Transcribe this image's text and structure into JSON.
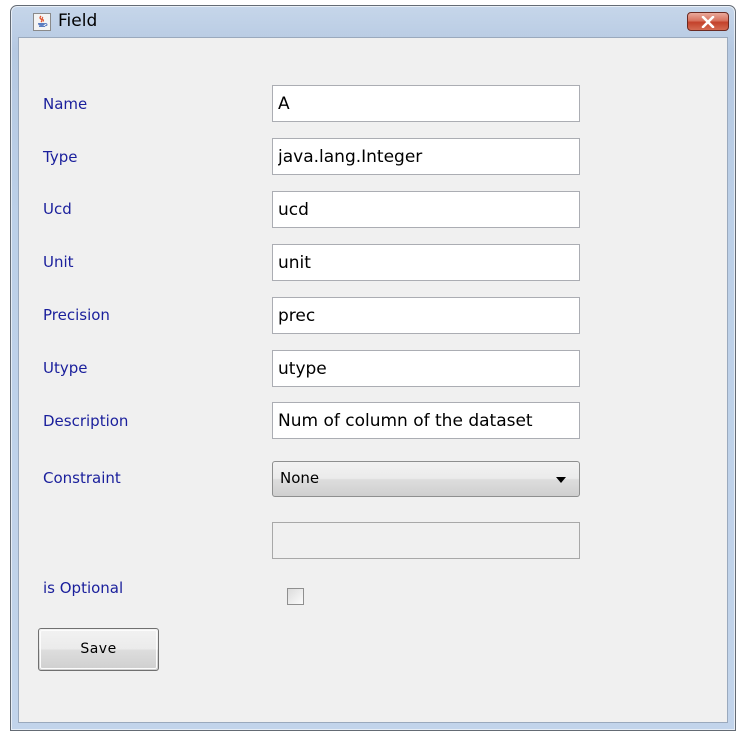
{
  "window": {
    "title": "Field",
    "app_icon": "java-cup-icon",
    "close_icon": "close-icon"
  },
  "form": {
    "fields": [
      {
        "label": "Name",
        "value": "A"
      },
      {
        "label": "Type",
        "value": "java.lang.Integer"
      },
      {
        "label": "Ucd",
        "value": "ucd"
      },
      {
        "label": "Unit",
        "value": "unit"
      },
      {
        "label": "Precision",
        "value": "prec"
      },
      {
        "label": "Utype",
        "value": "utype"
      },
      {
        "label": "Description",
        "value": "Num of column of the dataset"
      }
    ],
    "constraint": {
      "label": "Constraint",
      "selected": "None"
    },
    "constraint_value": "",
    "optional": {
      "label": "is Optional",
      "checked": false
    },
    "save_label": "Save"
  },
  "colors": {
    "label": "#1a1f9c",
    "close_button": "#c4422b",
    "titlebar": "#bcd0e8"
  }
}
